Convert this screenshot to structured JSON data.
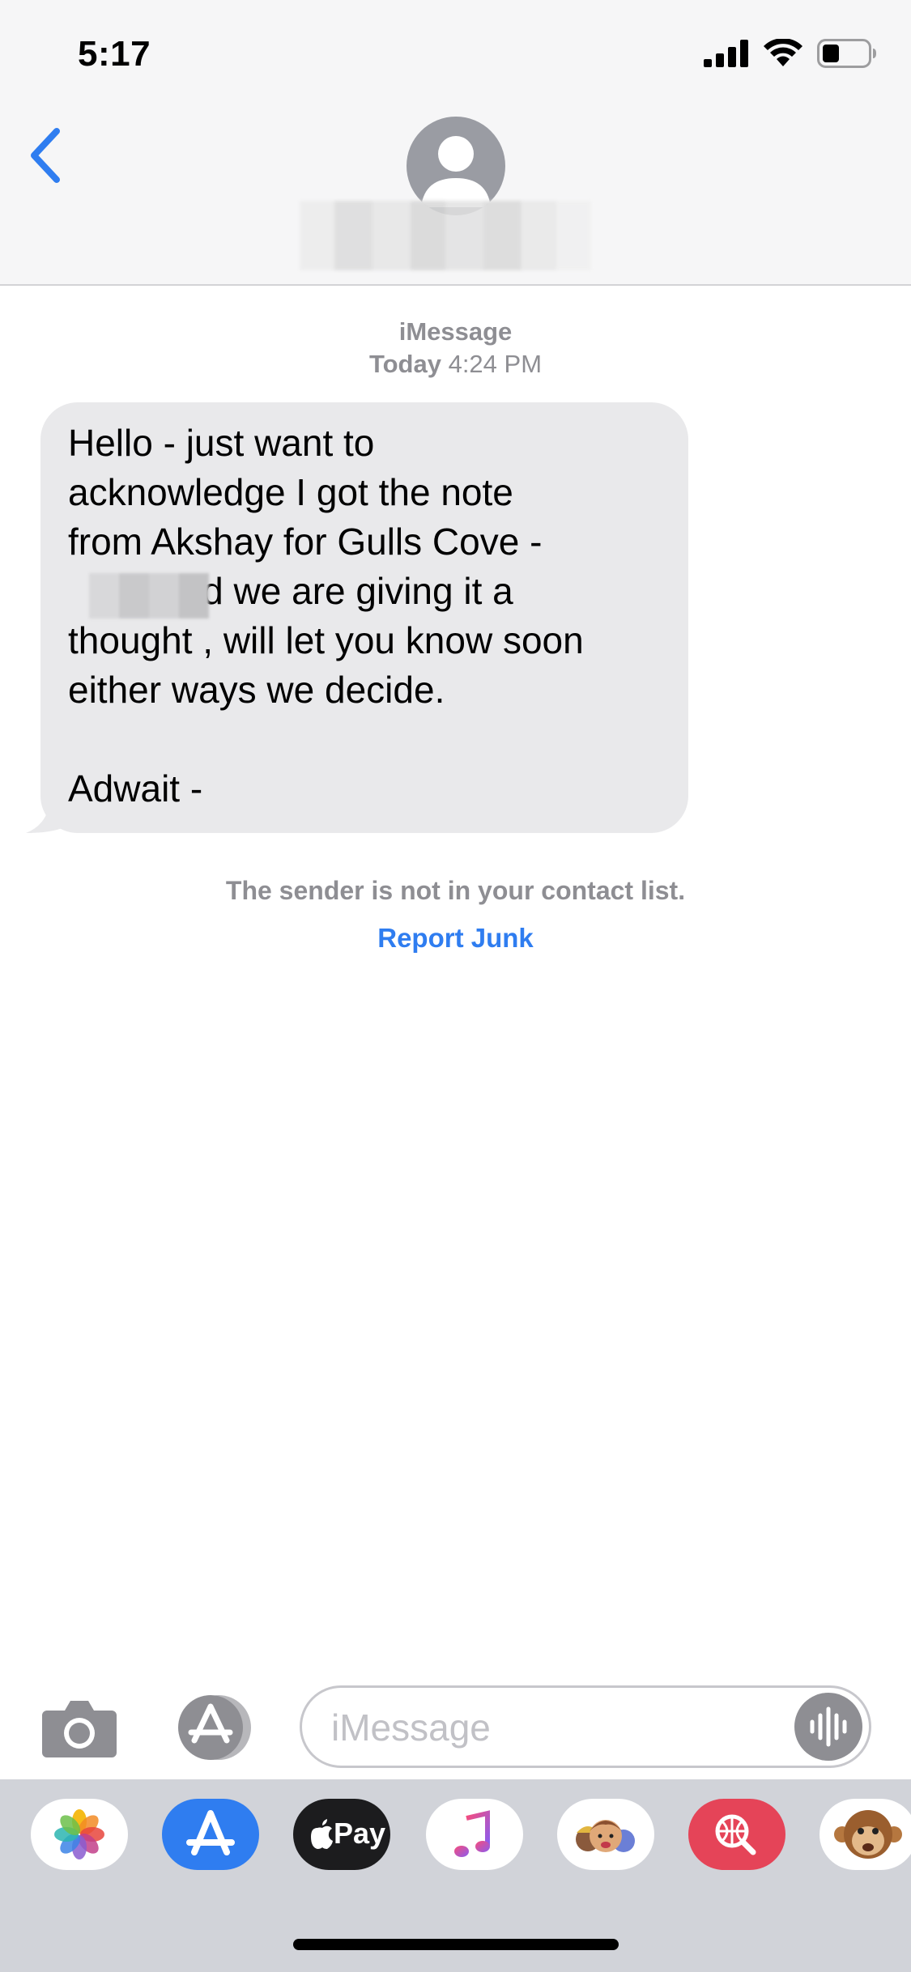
{
  "status_bar": {
    "time": "5:17"
  },
  "conversation": {
    "service": "iMessage",
    "date_label": "Today",
    "time_label": "4:24 PM",
    "message_text": "Hello - just want to\nacknowledge I got the note\nfrom Akshay for Gulls Cove -\n           nd we are giving it a\nthought , will let you know soon\neither ways we decide.\n\nAdwait -",
    "sender_notice": "The sender is not in your contact list.",
    "report_junk": "Report Junk"
  },
  "input": {
    "placeholder": "iMessage"
  },
  "app_drawer": {
    "apple_pay_label": "Pay"
  },
  "colors": {
    "accent": "#2f7df0",
    "bubble_gray": "#e9e9eb",
    "drawer": "#d1d3d9"
  }
}
